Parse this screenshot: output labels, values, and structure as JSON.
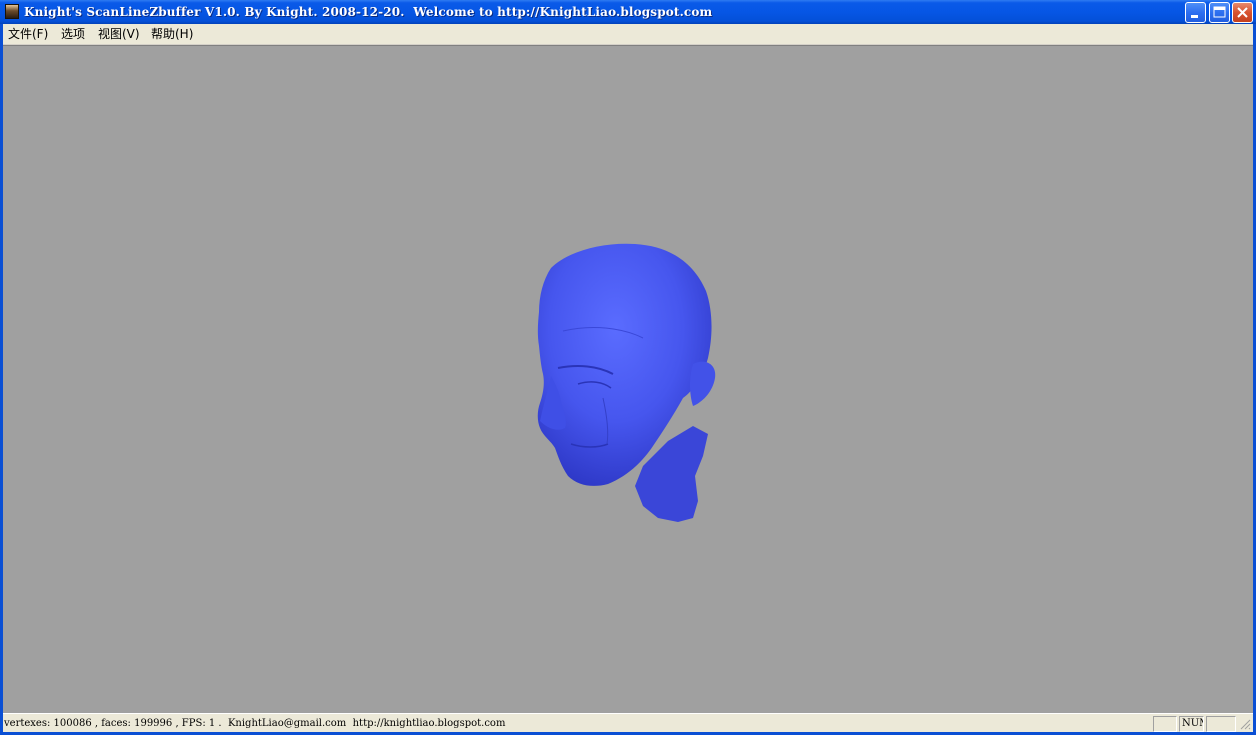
{
  "window": {
    "title": "Knight's ScanLineZbuffer V1.0. By Knight. 2008-12-20.  Welcome to http://KnightLiao.blogspot.com"
  },
  "titlebar_buttons": {
    "minimize": "minimize-icon",
    "maximize": "maximize-icon",
    "close": "close-icon"
  },
  "menu": {
    "items": [
      {
        "label": "文件(F)"
      },
      {
        "label": "选项"
      },
      {
        "label": "视图(V)"
      },
      {
        "label": "帮助(H)"
      }
    ]
  },
  "viewport": {
    "background_color": "#a0a0a0",
    "model_color": "#4a5cf0",
    "model": "3d-head-model"
  },
  "statusbar": {
    "text": "vertexes: 100086 , faces: 199996 , FPS: 1 .  KnightLiao@gmail.com  http://knightliao.blogspot.com",
    "caps": "",
    "num": "NUM",
    "scroll": ""
  }
}
